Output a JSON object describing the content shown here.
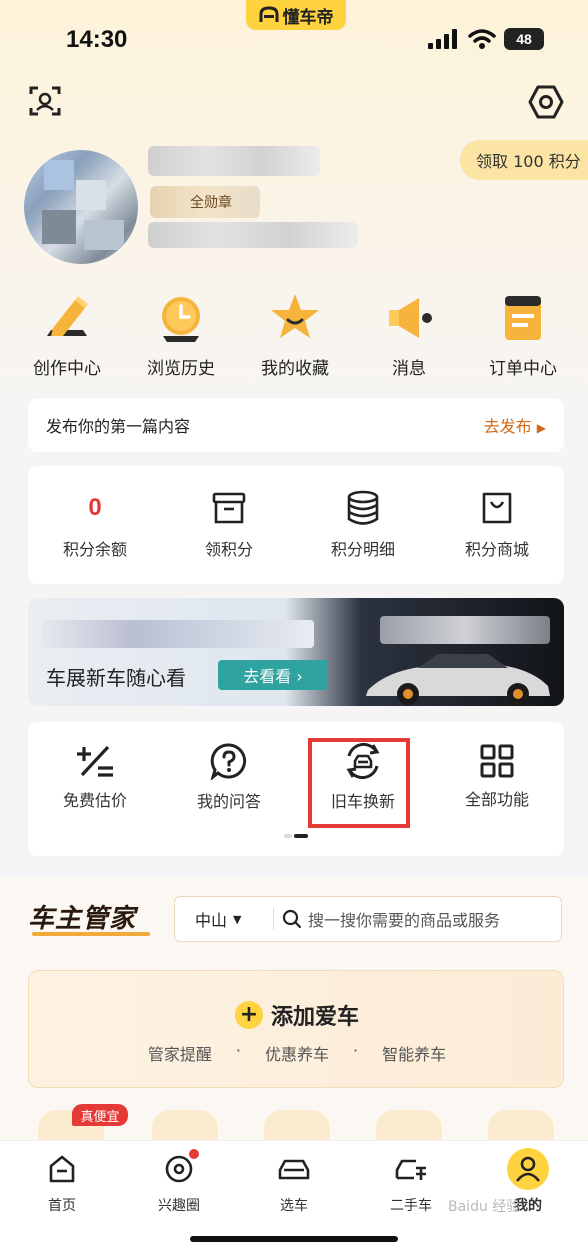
{
  "app": {
    "name": "懂车帝",
    "brand_color": "#ffd23f"
  },
  "status_bar": {
    "time": "14:30",
    "battery": "48"
  },
  "header": {
    "scan_icon": "scan-icon",
    "settings_icon": "settings-icon"
  },
  "profile": {
    "points_button": "领取 100 积分",
    "badge_text": "全勋章"
  },
  "quick_menu": [
    {
      "label": "创作中心",
      "icon": "pencil-icon"
    },
    {
      "label": "浏览历史",
      "icon": "clock-icon"
    },
    {
      "label": "我的收藏",
      "icon": "star-icon"
    },
    {
      "label": "消息",
      "icon": "megaphone-icon"
    },
    {
      "label": "订单中心",
      "icon": "order-icon"
    }
  ],
  "publish_card": {
    "text": "发布你的第一篇内容",
    "action": "去发布"
  },
  "points_card": {
    "items": [
      {
        "value": "0",
        "label": "积分余额"
      },
      {
        "label": "领积分",
        "icon": "box-icon"
      },
      {
        "label": "积分明细",
        "icon": "database-icon"
      },
      {
        "label": "积分商城",
        "icon": "bag-icon"
      }
    ]
  },
  "banner": {
    "subtitle": "车展新车随心看",
    "button": "去看看 ›"
  },
  "tools": [
    {
      "label": "免费估价",
      "icon": "calculator-icon"
    },
    {
      "label": "我的问答",
      "icon": "question-icon"
    },
    {
      "label": "旧车换新",
      "icon": "car-exchange-icon",
      "highlighted": true
    },
    {
      "label": "全部功能",
      "icon": "grid-icon"
    }
  ],
  "steward": {
    "title": "车主管家",
    "city": "中山",
    "search_placeholder": "搜一搜你需要的商品或服务",
    "add_car": "添加爱车",
    "features": [
      "管家提醒",
      "·",
      "优惠养车",
      "·",
      "智能养车"
    ],
    "tag": "真便宜"
  },
  "tabbar": [
    {
      "label": "首页",
      "icon": "home-icon"
    },
    {
      "label": "兴趣圈",
      "icon": "circle-icon"
    },
    {
      "label": "选车",
      "icon": "car-icon"
    },
    {
      "label": "二手车",
      "icon": "used-car-icon"
    },
    {
      "label": "我的",
      "icon": "user-icon",
      "active": true
    }
  ],
  "watermark": "Baidu 经验"
}
